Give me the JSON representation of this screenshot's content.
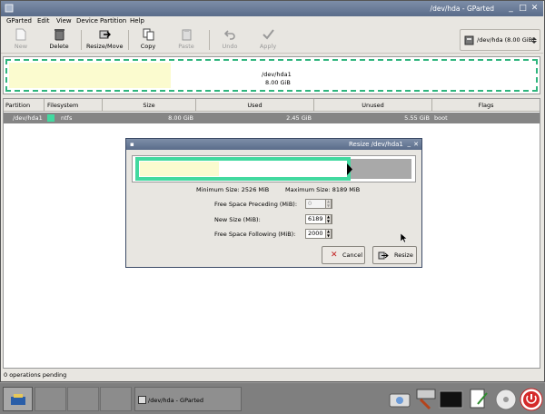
{
  "window": {
    "title": "/dev/hda - GParted"
  },
  "menu": [
    "GParted",
    "Edit",
    "View",
    "Device",
    "Partition",
    "Help"
  ],
  "toolbar": {
    "new": "New",
    "delete": "Delete",
    "resize_move": "Resize/Move",
    "copy": "Copy",
    "paste": "Paste",
    "undo": "Undo",
    "apply": "Apply",
    "device_selector": "/dev/hda  (8.00 GiB)"
  },
  "disk_graph": {
    "name": "/dev/hda1",
    "size": "8.00 GiB",
    "used_fraction": 0.3
  },
  "table": {
    "headers": [
      "Partition",
      "Filesystem",
      "Size",
      "Used",
      "Unused",
      "Flags"
    ],
    "rows": [
      {
        "partition": "/dev/hda1",
        "filesystem": "ntfs",
        "size": "8.00 GiB",
        "used": "2.45 GiB",
        "unused": "5.55 GiB",
        "flags": "boot",
        "fs_color": "#42d9a0"
      }
    ]
  },
  "status": "0 operations pending",
  "dialog": {
    "title": "Resize /dev/hda1",
    "min_size": "Minimum Size: 2526 MiB",
    "max_size": "Maximum Size: 8189 MiB",
    "preceding_label": "Free Space Preceding (MiB):",
    "preceding_value": "0",
    "new_size_label": "New Size (MiB):",
    "new_size_value": "6189",
    "following_label": "Free Space Following (MiB):",
    "following_value": "2000",
    "cancel": "Cancel",
    "resize": "Resize"
  },
  "taskbar": {
    "task_label": "/dev/hda - GParted"
  },
  "colors": {
    "titlebar": "#5a6c8a",
    "ntfs": "#42d9a0",
    "used": "#fbfbcf",
    "selected_row": "#858585"
  }
}
